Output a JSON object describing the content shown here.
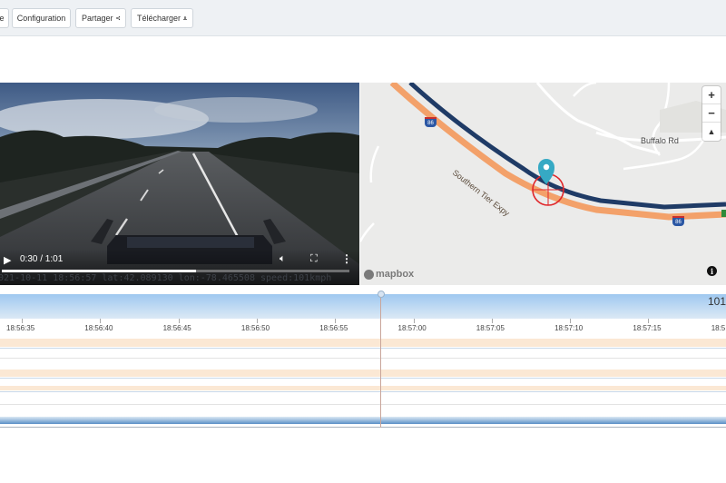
{
  "toolbar": {
    "partial_label": "e",
    "configuration_label": "Configuration",
    "share_label": "Partager",
    "download_label": "Télécharger"
  },
  "video": {
    "time_display": "0:30 / 1:01",
    "progress_fraction": 0.56,
    "overlay": "021-10-11 18:56:57 lat:42.089130 lon:-78.465508 speed:101kmph"
  },
  "map": {
    "road_labels": {
      "highway": "Southern Tier Expy",
      "buffalo": "Buffalo Rd",
      "shield_1": "86",
      "shield_2": "86"
    },
    "zoom_in": "+",
    "zoom_out": "−",
    "compass": "▲",
    "attribution": "mapbox",
    "info": "i",
    "colors": {
      "route_blue": "#1f3b66",
      "route_orange": "#f3a16a",
      "pin": "#36a9c4",
      "target": "#e0262a"
    }
  },
  "timeline": {
    "value_label": "101",
    "ticks": [
      "18:56:35",
      "18:56:40",
      "18:56:45",
      "18:56:50",
      "18:56:55",
      "18:57:00",
      "18:57:05",
      "18:57:10",
      "18:57:15",
      "18:5"
    ]
  }
}
